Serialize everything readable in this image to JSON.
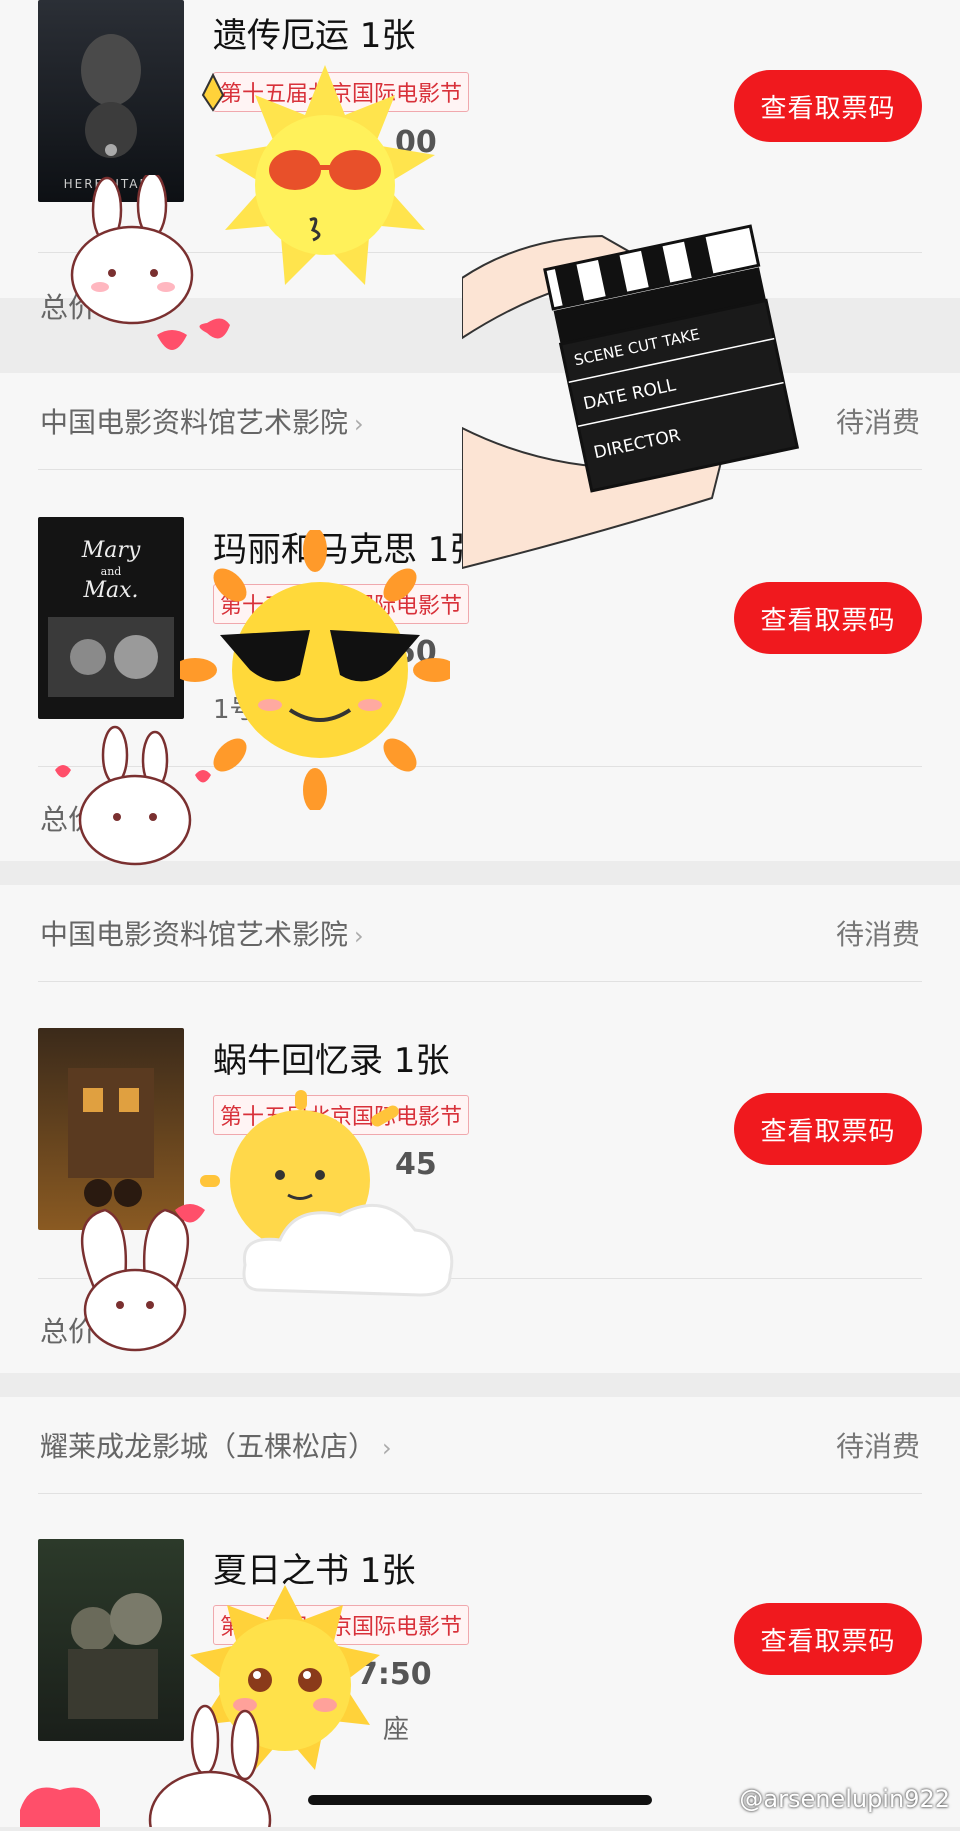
{
  "orders": [
    {
      "cinema": "",
      "status": "",
      "title": "遗传厄运 1张",
      "festival": "第十五届北京国际电影节",
      "time": "00",
      "seat": "",
      "total": "总价",
      "button": "查看取票码"
    },
    {
      "cinema": "中国电影资料馆艺术影院",
      "status": "待消费",
      "title": "玛丽和马克思 1张",
      "festival": "第十五届北京国际电影节",
      "time": "50",
      "seat": "1号",
      "total": "总价 元",
      "button": "查看取票码"
    },
    {
      "cinema": "中国电影资料馆艺术影院",
      "status": "待消费",
      "title": "蜗牛回忆录 1张",
      "festival": "第十五届北京国际电影节",
      "time": "45",
      "seat": "",
      "total": "总价 元",
      "button": "查看取票码"
    },
    {
      "cinema": "耀莱成龙影城（五棵松店）",
      "status": "待消费",
      "title": "夏日之书 1张",
      "festival": "第十五届北京国际电影节",
      "time": "7:50",
      "seat": "座",
      "total": "",
      "button": "查看取票码"
    }
  ],
  "watermark": "@arsenelupin922",
  "colors": {
    "accent": "#f0191e",
    "badge": "#d8313a"
  },
  "stickers": [
    "sun-sunglasses-sticker",
    "sun-black-sunglasses-sticker",
    "sun-cloud-sticker",
    "sun-blushing-sticker",
    "bunny-sticker",
    "clapperboard-sticker",
    "heart-sticker"
  ]
}
